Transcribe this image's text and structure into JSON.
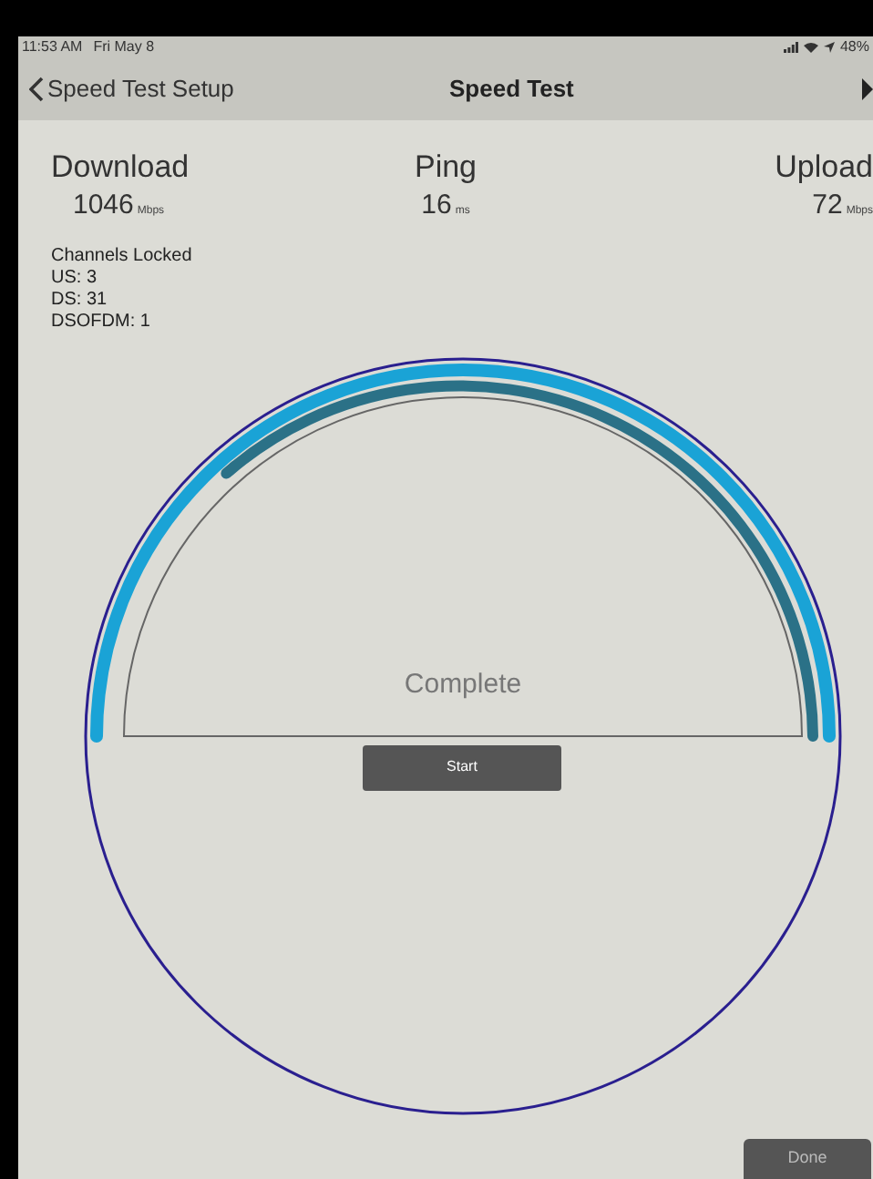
{
  "status_bar": {
    "time": "11:53 AM",
    "date": "Fri May 8",
    "battery": "48%"
  },
  "nav": {
    "back": "Speed Test Setup",
    "title": "Speed Test"
  },
  "stats": [
    {
      "label": "Download",
      "value": "1046",
      "unit": "Mbps"
    },
    {
      "label": "Ping",
      "value": "16",
      "unit": "ms"
    },
    {
      "label": "Upload",
      "value": "72",
      "unit": "Mbps"
    }
  ],
  "channels": {
    "title": "Channels Locked",
    "lines": [
      "US: 3",
      "DS: 31",
      "DSOFDM: 1"
    ]
  },
  "gauge": {
    "status": "Complete",
    "button": "Start"
  },
  "footer": {
    "button": "Done"
  }
}
